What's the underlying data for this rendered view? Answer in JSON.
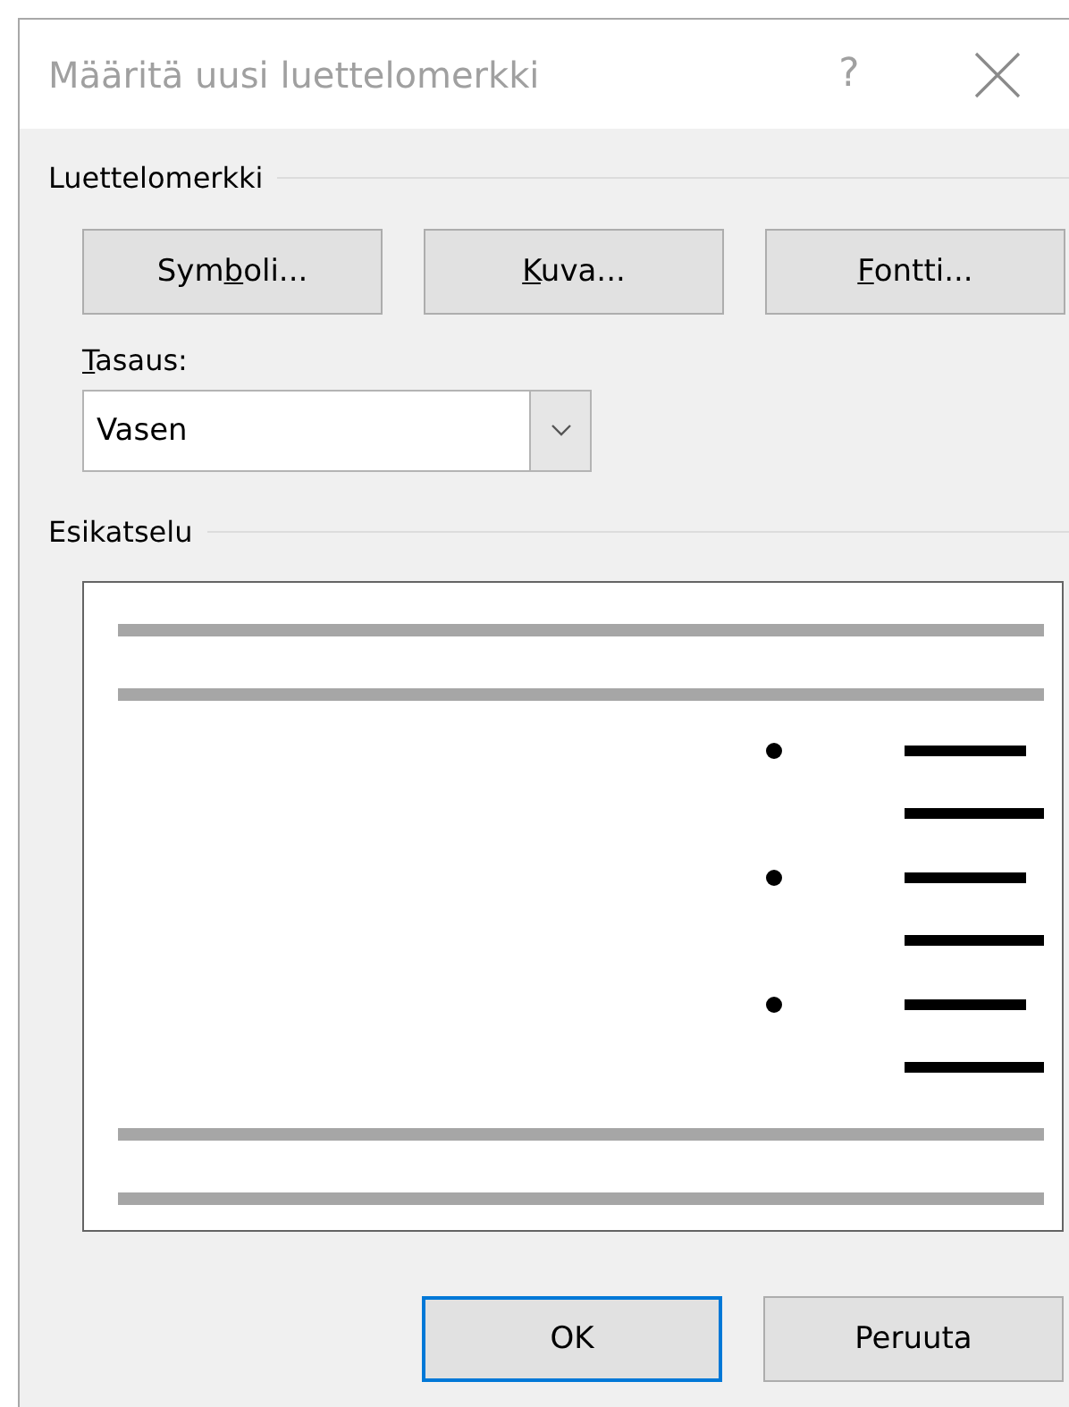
{
  "window": {
    "title": "Määritä uusi luettelomerkki",
    "help": "?"
  },
  "bullet_section": {
    "title": "Luettelomerkki",
    "buttons": [
      {
        "before": "Sym",
        "key": "b",
        "after": "oli..."
      },
      {
        "key": "K",
        "after": "uva..."
      },
      {
        "key": "F",
        "after": "ontti..."
      }
    ]
  },
  "alignment": {
    "label": {
      "key": "T",
      "after": "asaus:"
    },
    "value": "Vasen"
  },
  "preview": {
    "title": "Esikatselu"
  },
  "footer": {
    "buttons": [
      {
        "label": "OK",
        "selected": true
      },
      {
        "label": "Peruuta",
        "selected": false
      }
    ]
  }
}
